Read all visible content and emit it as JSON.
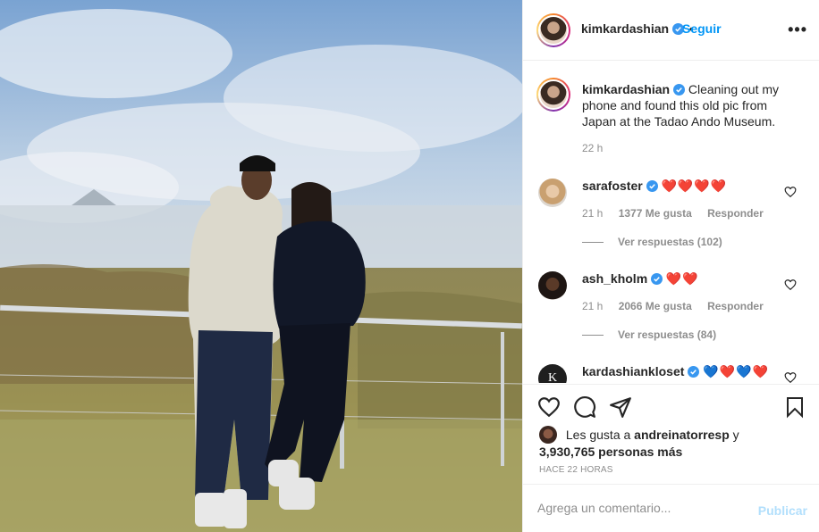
{
  "post": {
    "image_alt": "Couple posing in front of a mountain landscape"
  },
  "header": {
    "username": "kimkardashian",
    "follow_label": "Seguir",
    "more_label": "•••"
  },
  "caption": {
    "username": "kimkardashian",
    "text": "Cleaning out my phone and found this old pic from Japan at the Tadao Ando Museum.",
    "time": "22 h"
  },
  "comments": [
    {
      "username": "sarafoster",
      "text": "❤️❤️❤️❤️",
      "time": "21 h",
      "likes": "1377 Me gusta",
      "reply_label": "Responder",
      "view_replies": "Ver respuestas (102)"
    },
    {
      "username": "ash_kholm",
      "text": "❤️❤️",
      "time": "21 h",
      "likes": "2066 Me gusta",
      "reply_label": "Responder",
      "view_replies": "Ver respuestas (84)"
    },
    {
      "username": "kardashiankloset",
      "text": "💙❤️💙❤️"
    }
  ],
  "likes": {
    "prefix": "Les gusta a",
    "user": "andreinatorresp",
    "joiner": "y",
    "count": "3,930,765 personas más"
  },
  "posted_ago": "HACE 22 HORAS",
  "add_comment": {
    "placeholder": "Agrega un comentario...",
    "publish_label": "Publicar"
  },
  "colors": {
    "accent": "#0095f6",
    "publish_disabled": "#b2dffc",
    "verified": "#3897f0",
    "muted": "#8e8e8e"
  }
}
